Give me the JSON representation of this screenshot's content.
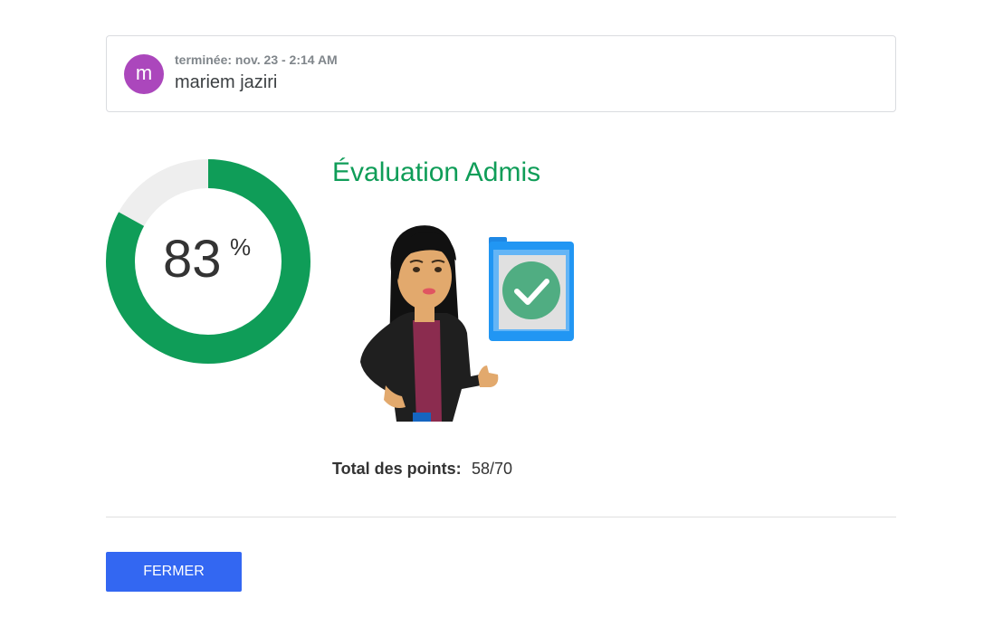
{
  "header": {
    "avatar_letter": "m",
    "completed_text": "terminée: nov. 23 - 2:14 AM",
    "user_name": "mariem jaziri"
  },
  "score": {
    "value": "83",
    "unit": "%",
    "fraction": 0.83,
    "ring_color": "#0f9d58",
    "track_color": "#eeeeee"
  },
  "result": {
    "title": "Évaluation Admis",
    "title_color": "#0f9d58",
    "illustration_icon": "woman-thumbs-up-with-checked-clipboard"
  },
  "total": {
    "label": "Total des points:",
    "value": "58/70"
  },
  "actions": {
    "close_label": "FERMER",
    "close_color": "#3367f2"
  },
  "colors": {
    "avatar": "#ab47bc"
  }
}
